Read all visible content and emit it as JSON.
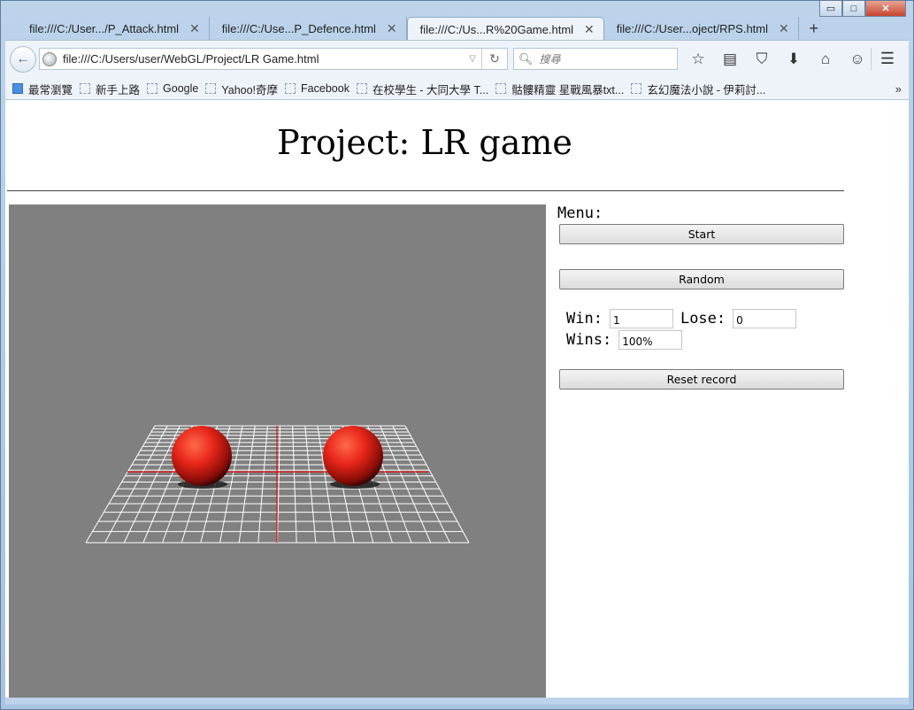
{
  "window": {
    "controls": {
      "minimize": "▭",
      "maximize": "□",
      "close": "✕"
    }
  },
  "tabs": [
    {
      "label": "file:///C:/User.../P_Attack.html",
      "active": false
    },
    {
      "label": "file:///C:/Use...P_Defence.html",
      "active": false
    },
    {
      "label": "file:///C:/Us...R%20Game.html",
      "active": true
    },
    {
      "label": "file:///C:/User...oject/RPS.html",
      "active": false
    }
  ],
  "navbar": {
    "url": "file:///C:/Users/user/WebGL/Project/LR Game.html",
    "search_placeholder": "搜尋"
  },
  "bookmarks": [
    "最常瀏覽",
    "新手上路",
    "Google",
    "Yahoo!奇摩",
    "Facebook",
    "在校學生 - 大同大學 T...",
    "骷髏精靈 星戰風暴txt...",
    "玄幻魔法小說 - 伊莉討..."
  ],
  "page": {
    "title": "Project: LR game",
    "menu_label": "Menu:",
    "start_button": "Start",
    "random_button": "Random",
    "win_label": "Win:",
    "win_value": "1",
    "lose_label": "Lose:",
    "lose_value": "0",
    "wins_label": "Wins:",
    "wins_value": "100%",
    "reset_button": "Reset record"
  },
  "colors": {
    "scene_bg": "#808080",
    "grid": "#ffffff",
    "axis": "#e01010",
    "sphere": "#e8261a"
  }
}
